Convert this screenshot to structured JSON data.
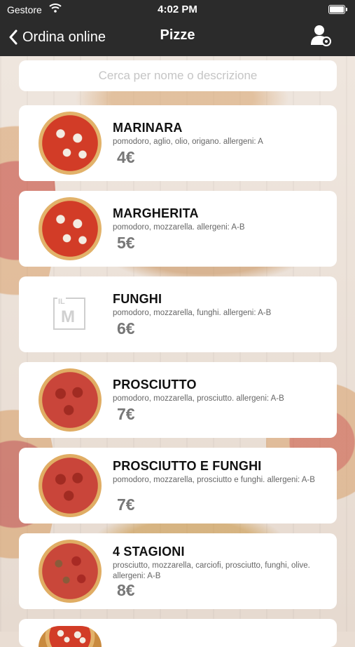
{
  "status_bar": {
    "carrier": "Gestore",
    "time": "4:02 PM"
  },
  "nav": {
    "back_label": "Ordina online",
    "title": "Pizze"
  },
  "search": {
    "placeholder": "Cerca per nome o descrizione",
    "value": ""
  },
  "logo_letters": {
    "top": "IL",
    "main": "M"
  },
  "products": [
    {
      "name": "MARINARA",
      "description": "pomodoro, aglio, olio, origano. allergeni: A",
      "price": "4€",
      "image": "pizza-marinara"
    },
    {
      "name": "MARGHERITA",
      "description": "pomodoro, mozzarella. allergeni: A-B",
      "price": "5€",
      "image": "pizza-margherita"
    },
    {
      "name": "FUNGHI",
      "description": "pomodoro, mozzarella, funghi. allergeni: A-B",
      "price": "6€",
      "image": "logo-placeholder"
    },
    {
      "name": "PROSCIUTTO",
      "description": "pomodoro, mozzarella, prosciutto. allergeni: A-B",
      "price": "7€",
      "image": "pizza-prosciutto"
    },
    {
      "name": "PROSCIUTTO E FUNGHI",
      "description": "pomodoro, mozzarella, prosciutto e funghi. allergeni: A-B",
      "price": "7€",
      "image": "pizza-prosciutto-funghi"
    },
    {
      "name": "4 STAGIONI",
      "description": "prosciutto, mozzarella, carciofi, prosciutto, funghi, olive. allergeni: A-B",
      "price": "8€",
      "image": "pizza-4-stagioni"
    }
  ],
  "colors": {
    "nav_bg": "#2b2b2b",
    "card_bg": "#ffffff",
    "price": "#777777"
  }
}
